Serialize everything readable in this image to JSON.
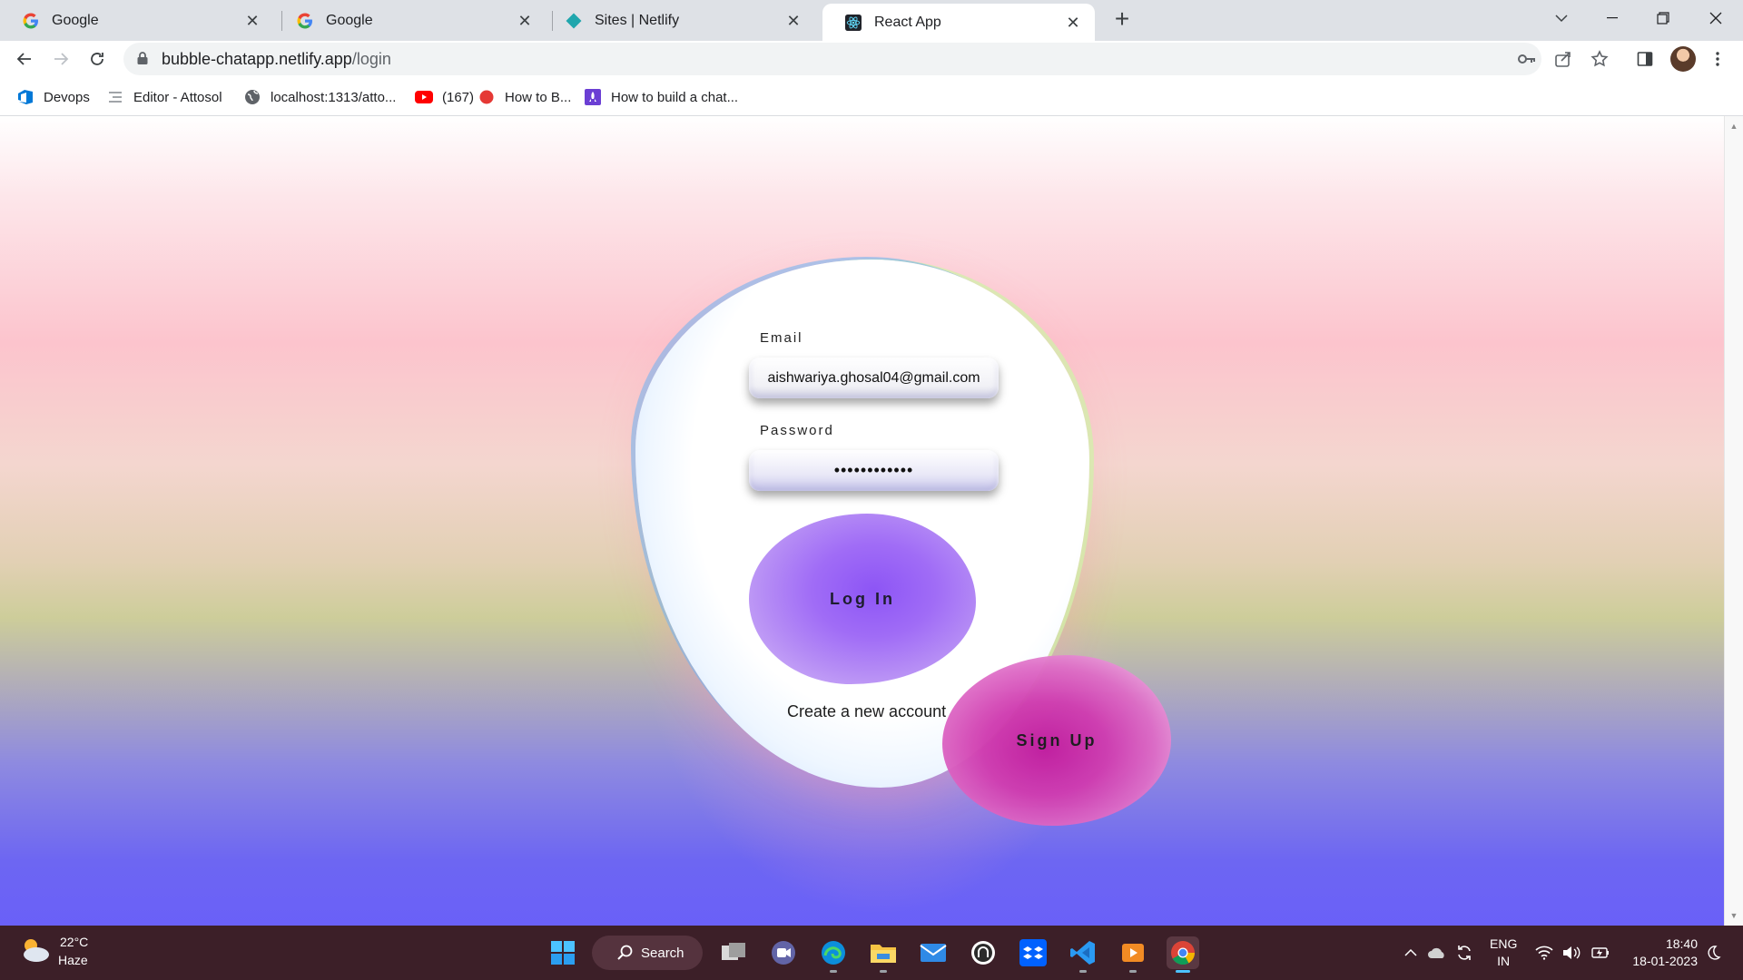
{
  "browser": {
    "tabs": [
      {
        "title": "Google",
        "icon": "google-icon"
      },
      {
        "title": "Google",
        "icon": "google-icon"
      },
      {
        "title": "Sites | Netlify",
        "icon": "netlify-icon"
      },
      {
        "title": "React App",
        "icon": "react-icon",
        "active": true
      }
    ],
    "url_host": "bubble-chatapp.netlify.app",
    "url_path": "/login",
    "bookmarks": [
      {
        "label": "Devops",
        "icon": "azure-devops-icon"
      },
      {
        "label": "Editor - Attosol",
        "icon": "list-icon"
      },
      {
        "label": "localhost:1313/atto...",
        "icon": "globe-icon"
      },
      {
        "label": "(167)",
        "icon": "youtube-icon"
      },
      {
        "label": "How to B...",
        "icon": "red-dot-icon"
      },
      {
        "label": "How to build a chat...",
        "icon": "rocket-icon"
      }
    ]
  },
  "login": {
    "email_label": "Email",
    "email_value": "aishwariya.ghosal04@gmail.com",
    "password_label": "Password",
    "password_value": "••••••••••••",
    "login_button": "Log In",
    "create_account": "Create a new account",
    "signup_button": "Sign Up"
  },
  "taskbar": {
    "weather_temp": "22°C",
    "weather_cond": "Haze",
    "search_label": "Search",
    "lang_top": "ENG",
    "lang_bottom": "IN",
    "time": "18:40",
    "date": "18-01-2023"
  },
  "colors": {
    "login_bubble": "#a06cf6",
    "signup_bubble": "#d03cb0",
    "taskbar": "#3c1f28"
  }
}
